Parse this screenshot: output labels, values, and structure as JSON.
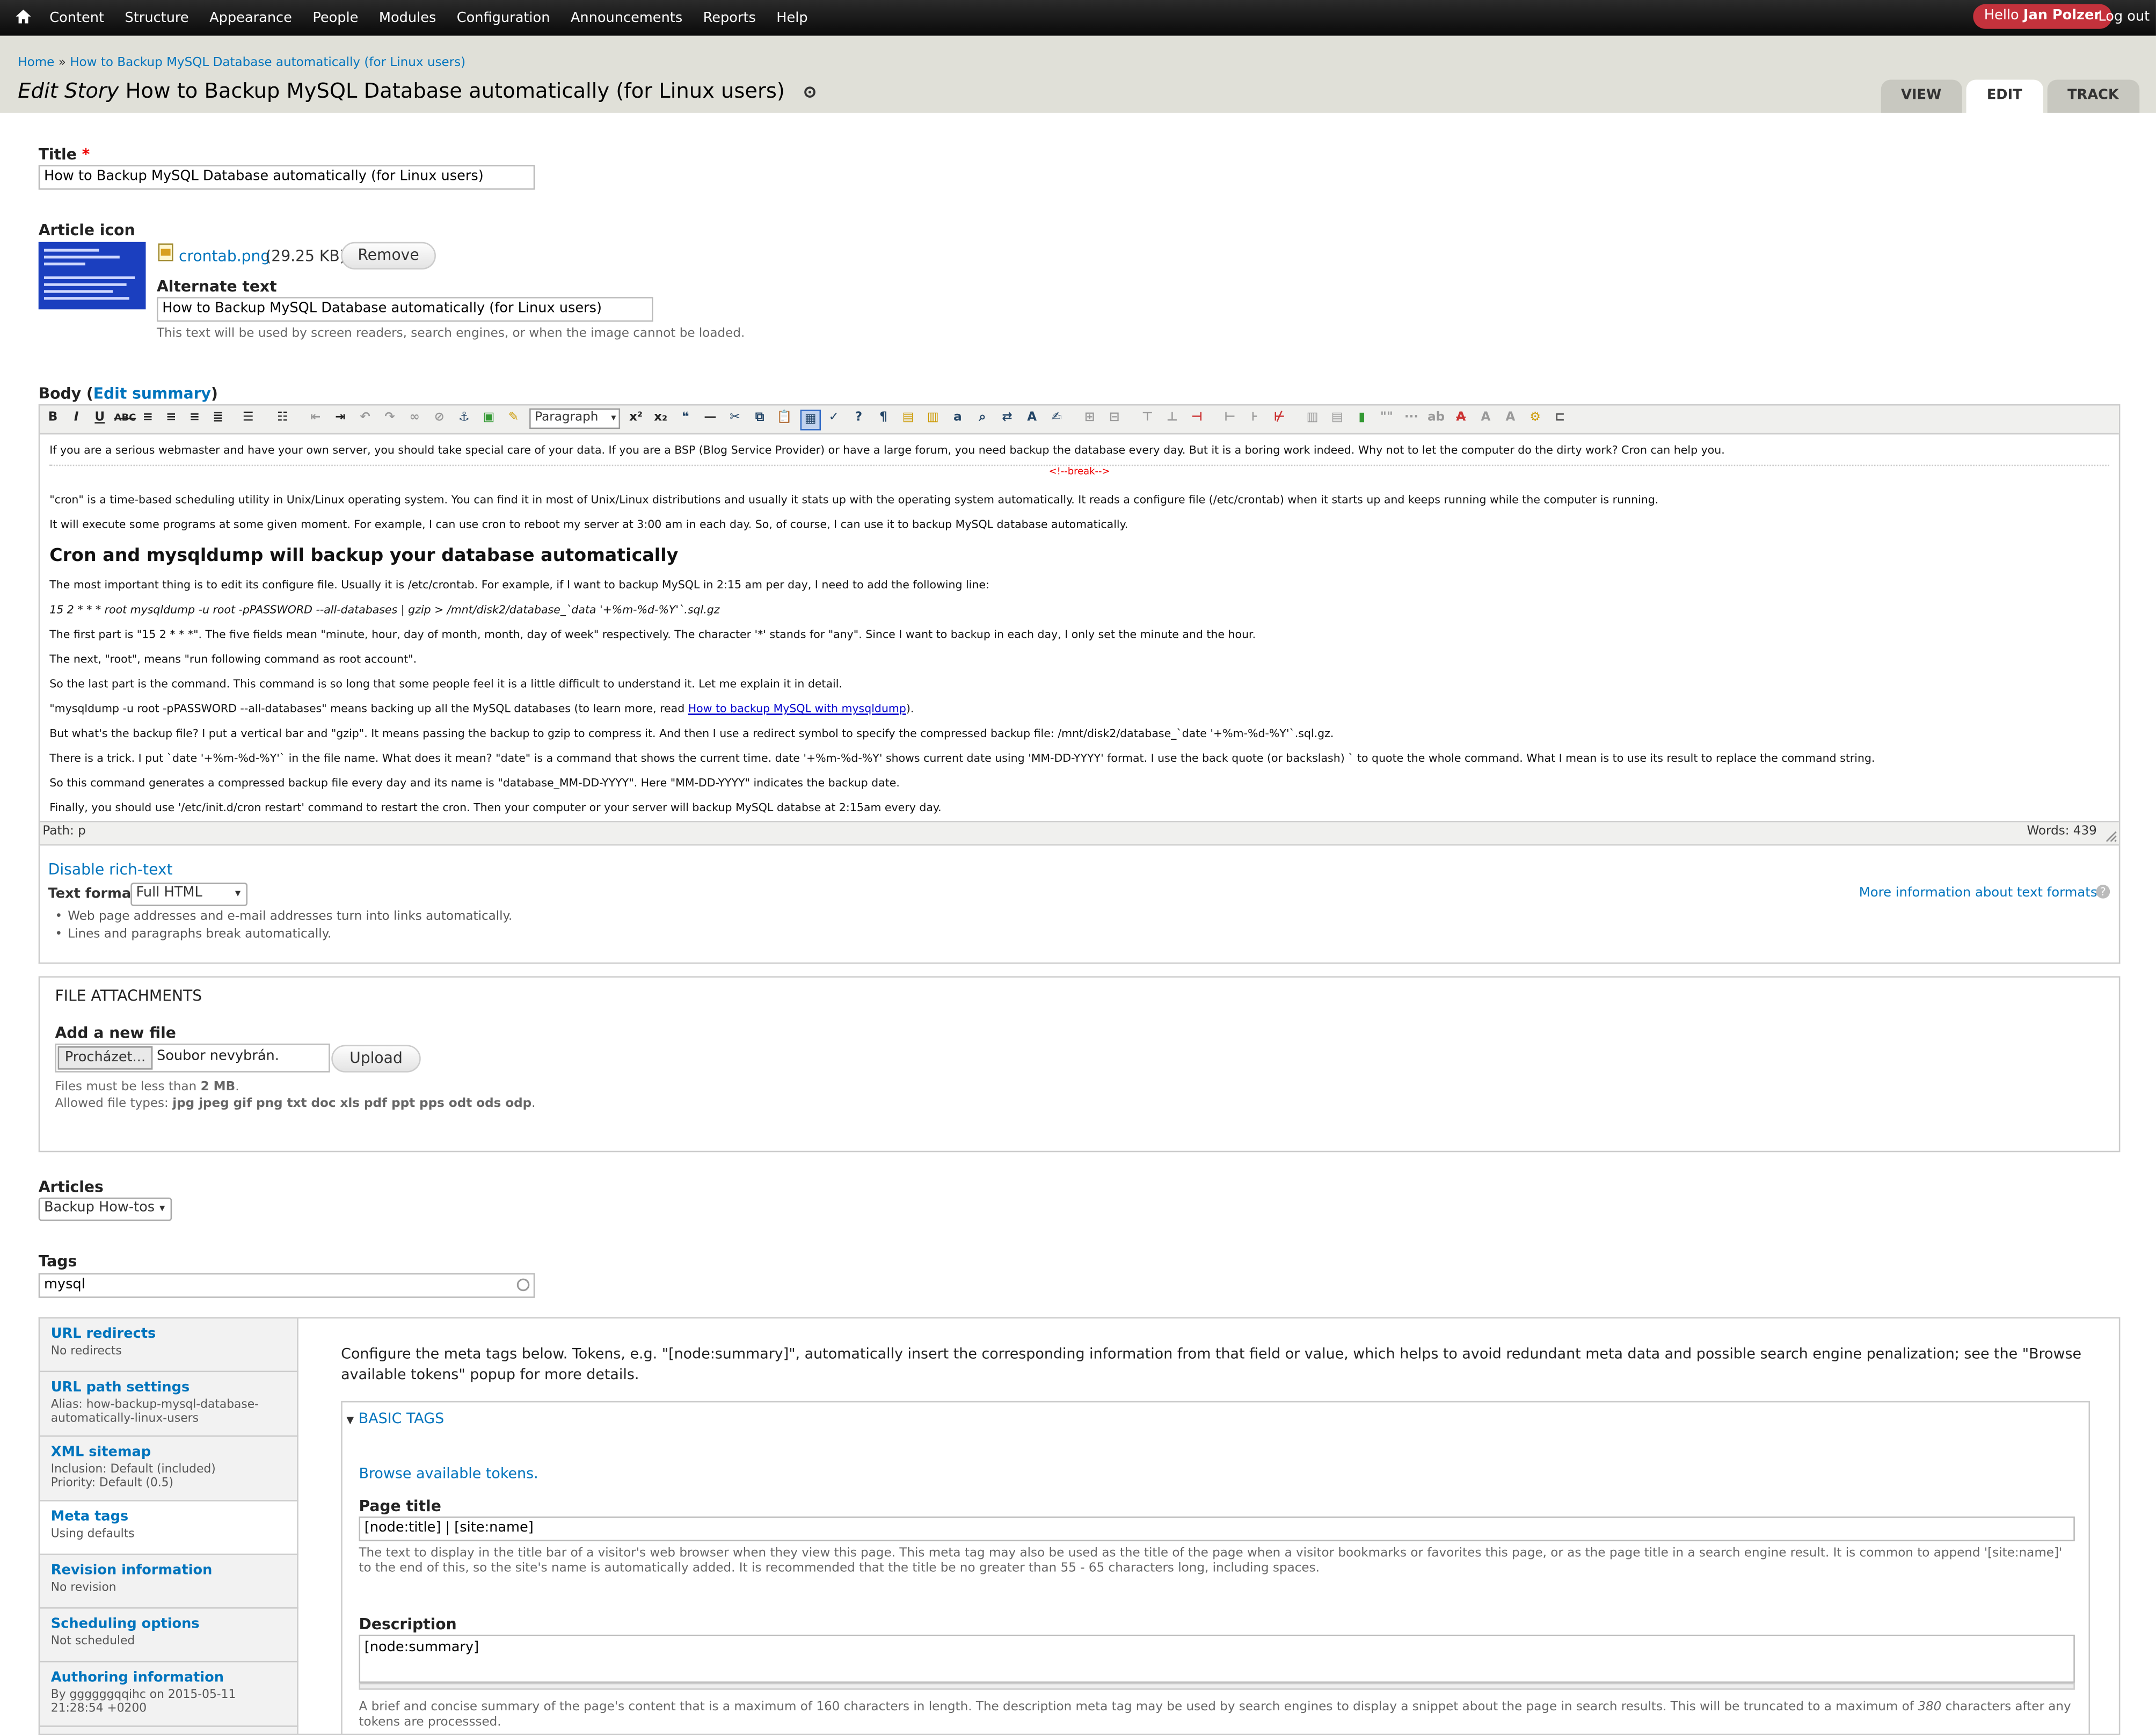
{
  "toolbar": {
    "menu": [
      "Content",
      "Structure",
      "Appearance",
      "People",
      "Modules",
      "Configuration",
      "Announcements",
      "Reports",
      "Help"
    ],
    "hello_prefix": "Hello",
    "user_name": "Jan Polzer",
    "logout": "Log out"
  },
  "breadcrumb": {
    "home": "Home",
    "sep": "»",
    "current": "How to Backup MySQL Database automatically (for Linux users)"
  },
  "header": {
    "title_prefix": "Edit Story",
    "title": "How to Backup MySQL Database automatically (for Linux users)"
  },
  "tabs": [
    "VIEW",
    "EDIT",
    "TRACK"
  ],
  "form": {
    "title_label": "Title",
    "title_required": "*",
    "title_value": "How to Backup MySQL Database automatically (for Linux users)",
    "article_icon_label": "Article icon",
    "file_name": "crontab.png",
    "file_size": "(29.25 KB)",
    "remove_button": "Remove",
    "alt_label": "Alternate text",
    "alt_value": "How to Backup MySQL Database automatically (for Linux users)",
    "alt_desc": "This text will be used by screen readers, search engines, or when the image cannot be loaded.",
    "body_label": "Body (",
    "edit_summary": "Edit summary",
    "body_label_close": ")"
  },
  "editor": {
    "format_select": "Paragraph",
    "p1": "If you are a serious webmaster and have your own server, you should take special care of your data. If you are a BSP (Blog Service Provider) or have a large forum, you need backup the database every day. But it is a boring work indeed. Why not to let the computer do the dirty work? Cron can help you.",
    "break": "<!--break-->",
    "p2": "\"cron\" is a time-based scheduling utility in Unix/Linux operating system. You  can find it in most of Unix/Linux distributions and usually it stats up with the operating system automatically. It reads a configure file (/etc/crontab) when it starts up and keeps running while the computer is running.",
    "p3": "It will execute some programs at some given moment. For example, I can use cron to reboot my server at 3:00 am in each day. So, of course, I can use it to backup MySQL database automatically.",
    "h2": "Cron and mysqldump will backup your database automatically",
    "p4": "The most important thing is to edit its configure file. Usually it is /etc/crontab. For example, if I want to backup MySQL in 2:15 am per day, I need to add the following line:",
    "p5": "15 2 * * * root mysqldump -u root -pPASSWORD --all-databases | gzip > /mnt/disk2/database_`data '+%m-%d-%Y'`.sql.gz",
    "p6": "The first part is \"15 2 * * *\". The five fields mean \"minute, hour, day of month, month, day of week\" respectively. The character '*' stands for \"any\". Since I want to backup in each day, I only set the minute and the hour.",
    "p7": "The next, \"root\", means \"run following command as root account\".",
    "p8": "So the last part is the command. This command is so long that some people feel it is a little difficult to understand it. Let me explain it in detail.",
    "p9_a": "\"mysqldump -u root -pPASSWORD --all-databases\" means backing up all the MySQL databases (to learn more, read ",
    "p9_link": "How to backup MySQL with mysqldump",
    "p9_b": ").",
    "p10": "But what's the backup file? I put a vertical bar and \"gzip\". It means passing the backup to gzip to compress it. And then I use a redirect symbol to specify the compressed backup file: /mnt/disk2/database_`date '+%m-%d-%Y'`.sql.gz.",
    "p11": "There is a trick. I put `date '+%m-%d-%Y'` in the file name. What does it mean? \"date\" is a command that shows the current time. date '+%m-%d-%Y' shows current date using 'MM-DD-YYYY' format. I use the back quote (or backslash) ` to quote the whole command. What I mean is to use its result to replace the command string.",
    "p12": "So this command generates a compressed backup file every day and its name is \"database_MM-DD-YYYY\". Here \"MM-DD-YYYY\" indicates the backup date.",
    "p13": "Finally, you should use '/etc/init.d/cron restart' command to restart the cron. Then your computer or your server will backup MySQL databse at 2:15am every day.",
    "path": "Path: p",
    "words": "Words: 439"
  },
  "format": {
    "disable": "Disable rich-text",
    "label": "Text format",
    "value": "Full HTML",
    "more": "More information about text formats",
    "tips": [
      "Web page addresses and e-mail addresses turn into links automatically.",
      "Lines and paragraphs break automatically."
    ]
  },
  "attachments": {
    "legend": "FILE ATTACHMENTS",
    "add_label": "Add a new file",
    "browse": "Procházet...",
    "no_file": "Soubor nevybrán.",
    "upload": "Upload",
    "limit_prefix": "Files must be less than",
    "limit_value": "2 MB",
    "types_prefix": "Allowed file types:",
    "types": "jpg jpeg gif png txt doc xls pdf ppt pps odt ods odp"
  },
  "articles": {
    "label": "Articles",
    "value": "Backup How-tos"
  },
  "tags": {
    "label": "Tags",
    "value": "mysql"
  },
  "vtabs": [
    {
      "title": "URL redirects",
      "summary": "No redirects"
    },
    {
      "title": "URL path settings",
      "summary": "Alias: how-backup-mysql-database-automatically-linux-users"
    },
    {
      "title": "XML sitemap",
      "summary": "Inclusion: Default (included)\nPriority: Default (0.5)"
    },
    {
      "title": "Meta tags",
      "summary": "Using defaults"
    },
    {
      "title": "Revision information",
      "summary": "No revision"
    },
    {
      "title": "Scheduling options",
      "summary": "Not scheduled"
    },
    {
      "title": "Authoring information",
      "summary": "By ggggggqqihc on 2015-05-11 21:28:54 +0200"
    }
  ],
  "meta": {
    "intro": "Configure the meta tags below. Tokens, e.g. \"[node:summary]\", automatically insert the corresponding information from that field or value, which helps to avoid redundant meta data and possible search engine penalization; see the \"Browse available tokens\" popup for more details.",
    "basic_tags": "BASIC TAGS",
    "browse_tokens": "Browse available tokens.",
    "page_title_label": "Page title",
    "page_title_value": "[node:title] | [site:name]",
    "page_title_desc": "The text to display in the title bar of a visitor's web browser when they view this page. This meta tag may also be used as the title of the page when a visitor bookmarks or favorites this page, or as the page title in a search engine result. It is common to append '[site:name]' to the end of this, so the site's name is automatically added. It is recommended that the title be no greater than 55 - 65 characters long, including spaces.",
    "description_label": "Description",
    "description_value": "[node:summary]",
    "description_desc_a": "A brief and concise summary of the page's content that is a maximum of 160 characters in length. The description meta tag may be used by search engines to display a snippet about the page in search results. This will be truncated to a maximum of",
    "description_desc_num": "380",
    "description_desc_b": "characters after any tokens are processsed."
  }
}
